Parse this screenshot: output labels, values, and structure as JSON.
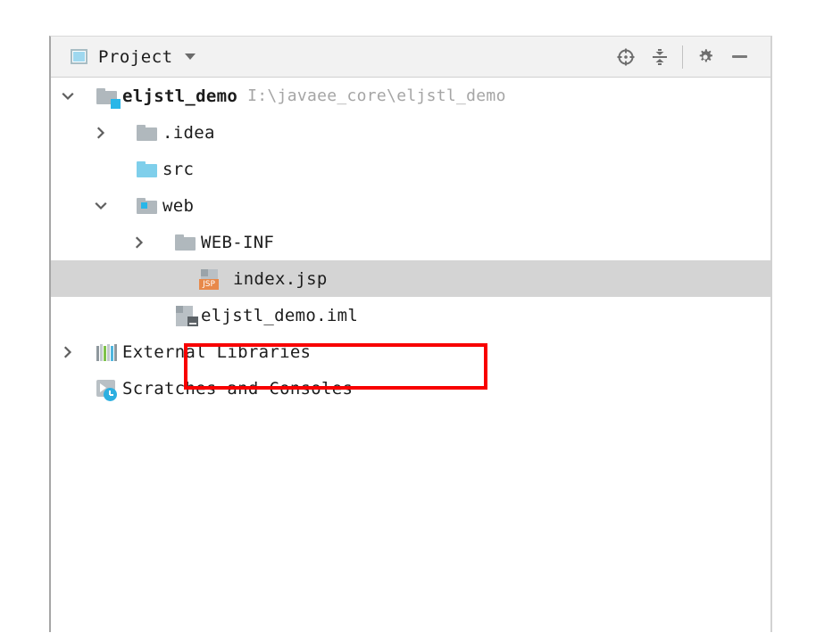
{
  "window": {
    "title": "Project",
    "title_icon": "project-toolwindow-icon",
    "dropdown_icon": "chevron-down-icon"
  },
  "toolbar": {
    "buttons": [
      {
        "name": "select-opened-file-button",
        "icon": "crosshair-locate-icon",
        "label": ""
      },
      {
        "name": "collapse-all-button",
        "icon": "collapse-all-icon",
        "label": ""
      },
      {
        "name": "settings-button",
        "icon": "gear-icon",
        "label": ""
      },
      {
        "name": "hide-button",
        "icon": "minimize-icon",
        "label": ""
      }
    ]
  },
  "tree": {
    "nodes": [
      {
        "label": "eljstl_demo",
        "path": "I:\\javaee_core\\eljstl_demo",
        "icon": "project-root-folder-icon",
        "twisty": "expanded",
        "depth": 0,
        "bold": true,
        "selected": false
      },
      {
        "label": ".idea",
        "path": "",
        "icon": "folder-icon",
        "twisty": "collapsed",
        "depth": 1,
        "bold": false,
        "selected": false
      },
      {
        "label": "src",
        "path": "",
        "icon": "source-folder-icon",
        "twisty": "none",
        "depth": 1,
        "bold": false,
        "selected": false
      },
      {
        "label": "web",
        "path": "",
        "icon": "web-resource-folder-icon",
        "twisty": "expanded",
        "depth": 1,
        "bold": false,
        "selected": false
      },
      {
        "label": "WEB-INF",
        "path": "",
        "icon": "folder-icon",
        "twisty": "collapsed",
        "depth": 2,
        "bold": false,
        "selected": false
      },
      {
        "label": "index.jsp",
        "path": "",
        "icon": "jsp-file-icon",
        "icon_badge_text": "JSP",
        "twisty": "none",
        "depth": 3,
        "bold": false,
        "selected": true
      },
      {
        "label": "eljstl_demo.iml",
        "path": "",
        "icon": "iml-module-file-icon",
        "twisty": "none",
        "depth": 2,
        "bold": false,
        "selected": false
      },
      {
        "label": "External Libraries",
        "path": "",
        "icon": "external-libraries-icon",
        "twisty": "collapsed",
        "depth": 0,
        "bold": false,
        "selected": false
      },
      {
        "label": "Scratches and Consoles",
        "path": "",
        "icon": "scratches-and-consoles-icon",
        "twisty": "none",
        "depth": 0,
        "bold": false,
        "selected": false
      }
    ]
  },
  "annotation": {
    "shape": "rectangle",
    "color": "#f80000",
    "target": "index.jsp"
  },
  "colors": {
    "selection_bg": "#d4d4d4",
    "titlebar_bg": "#f2f2f2",
    "folder_gray": "#b0b8bd",
    "folder_blue": "#7fcfeb",
    "accent_blue": "#29b6e8",
    "jsp_badge": "#e8894a",
    "path_text": "#a5a5a5",
    "annotation_red": "#f80000"
  }
}
